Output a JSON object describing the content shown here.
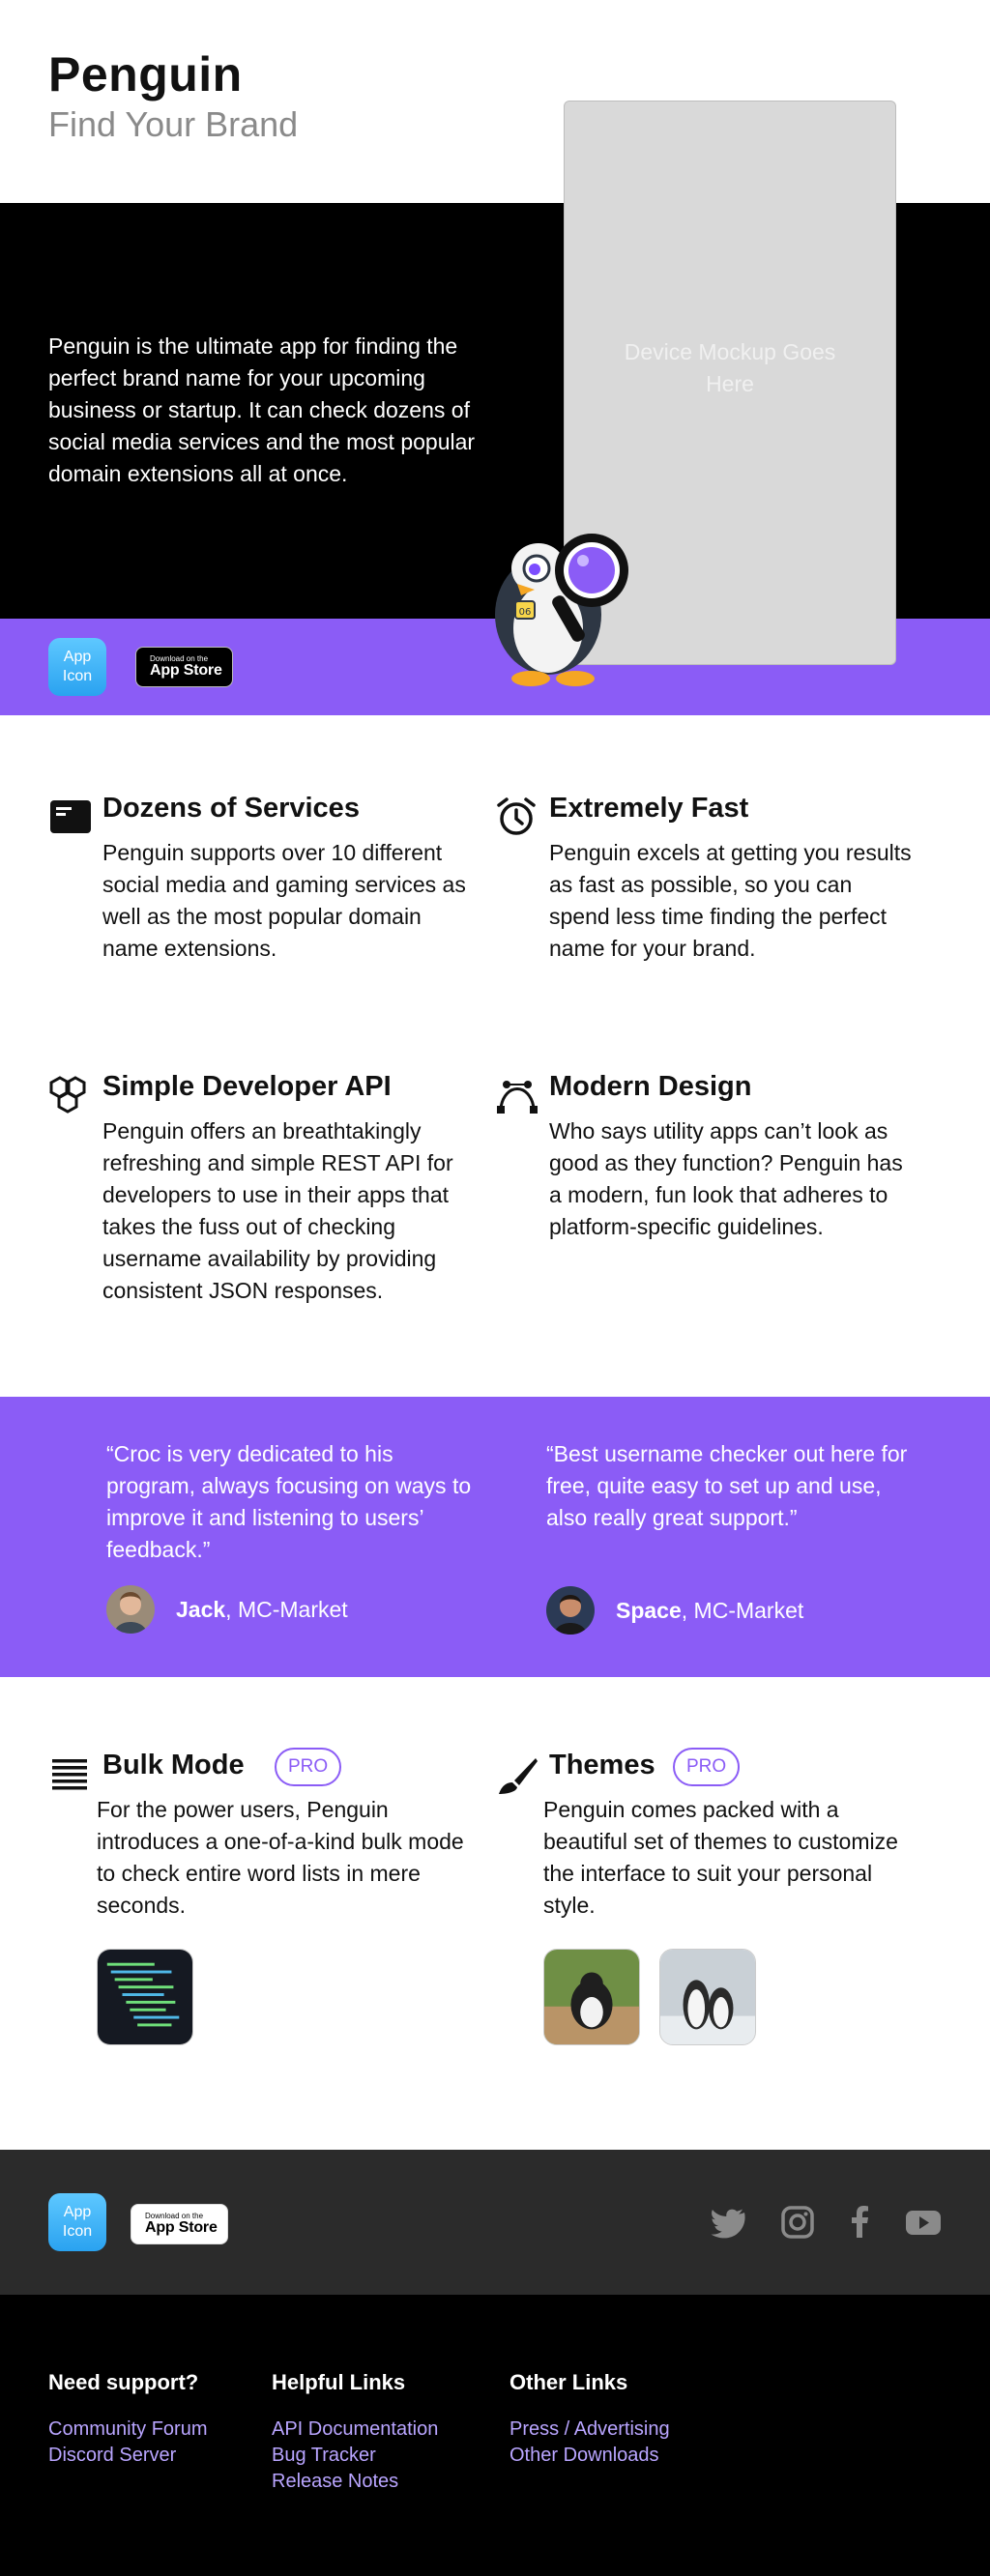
{
  "hero": {
    "brand": "Penguin",
    "tagline": "Find Your Brand",
    "description": "Penguin is the ultimate app for finding the perfect brand name for your upcoming business or startup. It can check dozens of social media services and the most popular domain extensions all at once.",
    "mockup_text": "Device Mockup Goes Here",
    "app_icon_label": "App Icon",
    "store_badge": {
      "small": "Download on the",
      "big": "App Store"
    },
    "mascot_tag": "06"
  },
  "features": [
    {
      "title": "Dozens of Services",
      "icon": "browser-window-icon",
      "text": "Penguin supports over 10 different social media and gaming services as well as the most popular domain name extensions."
    },
    {
      "title": "Extremely Fast",
      "icon": "alarm-clock-icon",
      "text": "Penguin excels at getting you results as fast as possible, so you can spend less time finding the perfect name for your brand."
    },
    {
      "title": "Simple Developer API",
      "icon": "cubes-icon",
      "text": "Penguin offers an breathtakingly refreshing and simple REST API for developers to use in their apps that takes the fuss out of checking username availability by providing consistent JSON responses."
    },
    {
      "title": "Modern Design",
      "icon": "bezier-curve-icon",
      "text": "Who says utility apps can’t look as good as they function? Penguin has a modern, fun look that adheres to platform-specific guidelines."
    }
  ],
  "testimonials": [
    {
      "quote": "“Croc is very dedicated to his program, always focusing on ways to improve it and listening to users’ feedback.”",
      "name": "Jack",
      "source": ", MC-Market"
    },
    {
      "quote": "“Best username checker out here for free, quite easy to set up and use, also really great support.”",
      "name": "Space",
      "source": ", MC-Market"
    }
  ],
  "pro_features": [
    {
      "title": "Bulk Mode",
      "badge": "PRO",
      "icon": "list-lines-icon",
      "text": "For the power users, Penguin introduces a one-of-a-kind bulk mode to check entire word lists in mere seconds."
    },
    {
      "title": "Themes",
      "badge": "PRO",
      "icon": "paintbrush-icon",
      "text": "Penguin comes packed with a beautiful set of themes to customize the interface to suit your personal style."
    }
  ],
  "footer": {
    "app_icon_label": "App Icon",
    "store_badge": {
      "small": "Download on the",
      "big": "App Store"
    },
    "social_icons": [
      "twitter-icon",
      "instagram-icon",
      "facebook-icon",
      "youtube-icon"
    ],
    "columns": [
      {
        "heading": "Need support?",
        "links": [
          "Community Forum",
          "Discord Server"
        ]
      },
      {
        "heading": "Helpful Links",
        "links": [
          "API Documentation",
          "Bug Tracker",
          "Release Notes"
        ]
      },
      {
        "heading": "Other Links",
        "links": [
          "Press / Advertising",
          "Other Downloads"
        ]
      }
    ]
  },
  "colors": {
    "accent": "#8b5cf6",
    "footer_grey": "#2b2b2b",
    "link": "#b9a5ff",
    "tagline": "#8a8a8a"
  }
}
